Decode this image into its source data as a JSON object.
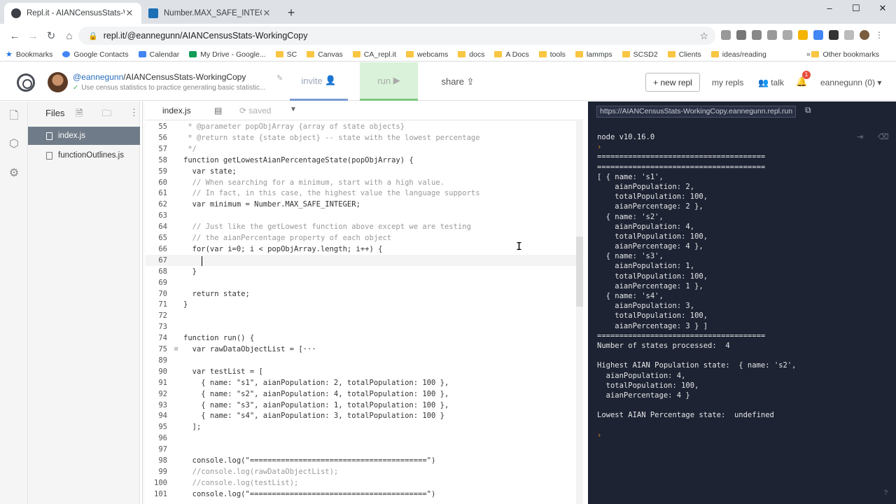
{
  "browser": {
    "tabs": [
      {
        "title": "Repl.it - AIANCensusStats-Workin",
        "active": true
      },
      {
        "title": "Number.MAX_SAFE_INTEGER - Ja",
        "active": false
      }
    ],
    "new_tab": "+",
    "window_controls": [
      "–",
      "☐",
      "✕"
    ],
    "url": "repl.it/@eannegunn/AIANCensusStats-WorkingCopy",
    "bookmarks": [
      "Bookmarks",
      "Google Contacts",
      "Calendar",
      "My Drive - Google...",
      "SC",
      "Canvas",
      "CA_repl.it",
      "webcams",
      "docs",
      "A Docs",
      "tools",
      "lammps",
      "SCSD2",
      "Clients",
      "ideas/reading"
    ],
    "bookmarks_more": "»",
    "other_bookmarks": "Other bookmarks"
  },
  "header": {
    "user": "@eannegunn",
    "repl_name": "/AIANCensusStats-WorkingCopy",
    "description": "Use census statistics to practice generating basic statistic...",
    "invite": "invite",
    "run": "run",
    "share": "share",
    "new_repl": "+ new repl",
    "my_repls": "my repls",
    "talk": "talk",
    "notif_count": "1",
    "account": "eannegunn (0)"
  },
  "files": {
    "title": "Files",
    "items": [
      {
        "name": "index.js",
        "active": true
      },
      {
        "name": "functionOutlines.js",
        "active": false
      }
    ]
  },
  "editor": {
    "tab": "index.js",
    "status": "saved",
    "lines": [
      {
        "n": "55",
        "t": " * @parameter popObjArray {array of state objects}",
        "c": "cmt"
      },
      {
        "n": "56",
        "t": " * @return state {state object} -- state with the lowest percentage",
        "c": "cmt"
      },
      {
        "n": "57",
        "t": " */",
        "c": "cmt"
      },
      {
        "n": "58",
        "t": "function getLowestAianPercentageState(popObjArray) {",
        "c": ""
      },
      {
        "n": "59",
        "t": "  var state;",
        "c": ""
      },
      {
        "n": "60",
        "t": "  // When searching for a minimum, start with a high value.",
        "c": "cmt"
      },
      {
        "n": "61",
        "t": "  // In fact, in this case, the highest value the language supports",
        "c": "cmt"
      },
      {
        "n": "62",
        "t": "  var minimum = Number.MAX_SAFE_INTEGER;",
        "c": ""
      },
      {
        "n": "63",
        "t": "",
        "c": ""
      },
      {
        "n": "64",
        "t": "  // Just like the getLowest function above except we are testing",
        "c": "cmt"
      },
      {
        "n": "65",
        "t": "  // the aianPercentage property of each object",
        "c": "cmt"
      },
      {
        "n": "66",
        "t": "  for(var i=0; i < popObjArray.length; i++) {",
        "c": ""
      },
      {
        "n": "67",
        "t": "",
        "c": "",
        "hl": true
      },
      {
        "n": "68",
        "t": "  }",
        "c": ""
      },
      {
        "n": "69",
        "t": "",
        "c": ""
      },
      {
        "n": "70",
        "t": "  return state;",
        "c": ""
      },
      {
        "n": "71",
        "t": "}",
        "c": ""
      },
      {
        "n": "72",
        "t": "",
        "c": ""
      },
      {
        "n": "73",
        "t": "",
        "c": ""
      },
      {
        "n": "74",
        "t": "function run() {",
        "c": ""
      },
      {
        "n": "75",
        "t": "  var rawDataObjectList = [···",
        "c": "",
        "fold": true
      },
      {
        "n": "89",
        "t": "",
        "c": ""
      },
      {
        "n": "90",
        "t": "  var testList = [",
        "c": ""
      },
      {
        "n": "91",
        "t": "    { name: \"s1\", aianPopulation: 2, totalPopulation: 100 },",
        "c": ""
      },
      {
        "n": "92",
        "t": "    { name: \"s2\", aianPopulation: 4, totalPopulation: 100 },",
        "c": ""
      },
      {
        "n": "93",
        "t": "    { name: \"s3\", aianPopulation: 1, totalPopulation: 100 },",
        "c": ""
      },
      {
        "n": "94",
        "t": "    { name: \"s4\", aianPopulation: 3, totalPopulation: 100 }",
        "c": ""
      },
      {
        "n": "95",
        "t": "  ];",
        "c": ""
      },
      {
        "n": "96",
        "t": "",
        "c": ""
      },
      {
        "n": "97",
        "t": "",
        "c": ""
      },
      {
        "n": "98",
        "t": "  console.log(\"========================================\")",
        "c": ""
      },
      {
        "n": "99",
        "t": "  //console.log(rawDataObjectList);",
        "c": "cmt"
      },
      {
        "n": "100",
        "t": "  //console.log(testList);",
        "c": "cmt"
      },
      {
        "n": "101",
        "t": "  console.log(\"========================================\")",
        "c": ""
      }
    ]
  },
  "console": {
    "url": "https://AIANCensusStats-WorkingCopy.eannegunn.repl.run",
    "lines": [
      "node v10.16.0",
      "›",
      "======================================",
      "======================================",
      "[ { name: 's1',",
      "    aianPopulation: 2,",
      "    totalPopulation: 100,",
      "    aianPercentage: 2 },",
      "  { name: 's2',",
      "    aianPopulation: 4,",
      "    totalPopulation: 100,",
      "    aianPercentage: 4 },",
      "  { name: 's3',",
      "    aianPopulation: 1,",
      "    totalPopulation: 100,",
      "    aianPercentage: 1 },",
      "  { name: 's4',",
      "    aianPopulation: 3,",
      "    totalPopulation: 100,",
      "    aianPercentage: 3 } ]",
      "======================================",
      "Number of states processed:  4",
      "",
      "Highest AIAN Population state:  { name: 's2',",
      "  aianPopulation: 4,",
      "  totalPopulation: 100,",
      "  aianPercentage: 4 }",
      "",
      "Lowest AIAN Percentage state:  undefined",
      "",
      "›"
    ]
  }
}
